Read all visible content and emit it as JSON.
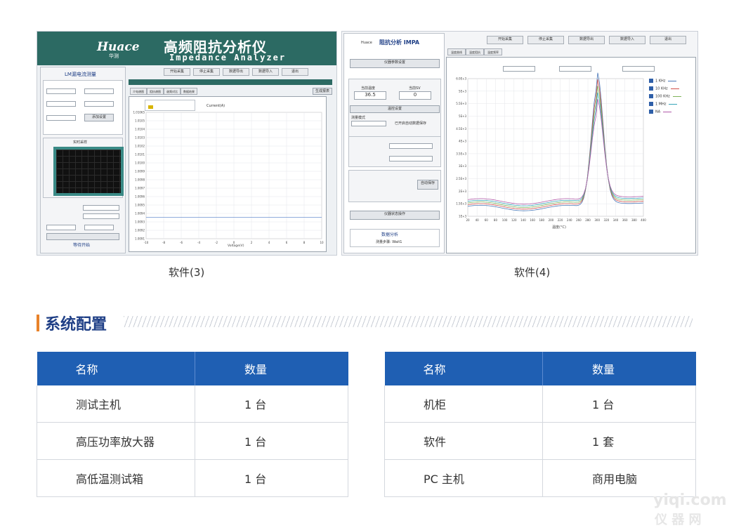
{
  "screenshot3": {
    "logo": "Huace",
    "logo_sub": "华测",
    "title": "高频阻抗分析仪",
    "subtitle": "Impedance Analyzer",
    "left_panel_title": "LM漏电流测量",
    "buttons": [
      "开始采集",
      "停止采集",
      "数据导出",
      "数据导入",
      "退出"
    ],
    "tabs": [
      "介电谱图",
      "阻抗谱图",
      "谐频对比",
      "数据结果"
    ],
    "side_btn_generate": "生成报表",
    "param_btn": "添加设置",
    "realtime_label": "实时采样",
    "status_label": "等待开始",
    "curve_label": "Current(A)",
    "x_axis_label": "Voltage(V)",
    "y_ticks": [
      "1.01065",
      "1.0105",
      "1.0104",
      "1.0103",
      "1.0102",
      "1.0101",
      "1.0100",
      "1.0099",
      "1.0098",
      "1.0097",
      "1.0096",
      "1.0095",
      "1.0094",
      "1.0093",
      "1.0092",
      "1.0091"
    ],
    "x_ticks": [
      "-10",
      "-8",
      "-6",
      "-4",
      "-2",
      "0",
      "2",
      "4",
      "6",
      "8",
      "10"
    ]
  },
  "screenshot4": {
    "logo": "Huace",
    "title": "阻抗分析 IMPA",
    "btn_device": "仪器参数设置",
    "temp_label": "当前温度",
    "temp_value": "36.5",
    "voltage_label": "当前SV",
    "voltage_value": "0",
    "btn_heat": "温控设置",
    "mode_label": "测量模式",
    "checkbox_label": "已开启自动数据保存",
    "btn_save": "自动保存",
    "btn_report": "仪器状态操作",
    "status_title": "数据分析",
    "status_sub": "测量步骤: Wait1",
    "buttons": [
      "开始采集",
      "停止采集",
      "数据导出",
      "数据导入",
      "退出"
    ],
    "tabs": [
      "温度曲线",
      "温度阻抗",
      "温度频率"
    ],
    "legend": [
      {
        "name": "1 KHz",
        "color": "#4a78b8"
      },
      {
        "name": "10 KHz",
        "color": "#d0504a"
      },
      {
        "name": "100 KHz",
        "color": "#7fb35a"
      },
      {
        "name": "1 MHz",
        "color": "#36a5b8"
      },
      {
        "name": "NA",
        "color": "#b05aa8"
      }
    ],
    "x_ticks": [
      "20",
      "40",
      "60",
      "80",
      "100",
      "120",
      "140",
      "160",
      "180",
      "200",
      "220",
      "240",
      "260",
      "280",
      "300",
      "320",
      "340",
      "360",
      "380",
      "400"
    ],
    "x_label": "温度(°C)",
    "y_ticks": [
      "6.0E+3",
      "5E+3",
      "5.5E+3",
      "5E+3",
      "4.5E+3",
      "4E+3",
      "3.5E+3",
      "3E+3",
      "2.5E+3",
      "2E+3",
      "1.5E+3",
      "1E+3"
    ]
  },
  "captions": [
    "软件(3)",
    "软件(4)"
  ],
  "section": {
    "title": "系统配置"
  },
  "table_left": {
    "headers": [
      "名称",
      "数量"
    ],
    "rows": [
      [
        "测试主机",
        "1 台"
      ],
      [
        "高压功率放大器",
        "1 台"
      ],
      [
        "高低温测试箱",
        "1 台"
      ]
    ]
  },
  "table_right": {
    "headers": [
      "名称",
      "数量"
    ],
    "rows": [
      [
        "机柜",
        "1 台"
      ],
      [
        "软件",
        "1 套"
      ],
      [
        "PC 主机",
        "商用电脑"
      ]
    ]
  },
  "watermark": {
    "line1": "yiqi.com",
    "line2": "仪 器 网"
  }
}
